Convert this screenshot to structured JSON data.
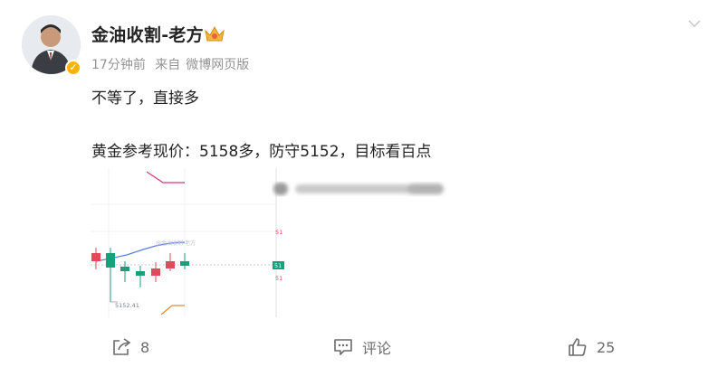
{
  "post": {
    "author": "金油收割-老方",
    "time": "17分钟前",
    "source_prefix": "来自",
    "source": "微博网页版",
    "text_line1": "不等了，直接多",
    "text_line2": "黄金参考现价：5158多，防守5152，目标看百点"
  },
  "chart_image": {
    "price_label": "5152.41",
    "axis_label_1": "51",
    "axis_label_2": "51",
    "axis_label_3": "51",
    "colors": {
      "up": "#e04a5a",
      "down": "#17a07a",
      "ma": "#5b7fe0",
      "zone": "#d63384",
      "low": "#e08a3a"
    }
  },
  "actions": {
    "share_count": "8",
    "comment_label": "评论",
    "like_count": "25",
    "icons": [
      "share-icon",
      "comment-icon",
      "like-icon"
    ]
  }
}
